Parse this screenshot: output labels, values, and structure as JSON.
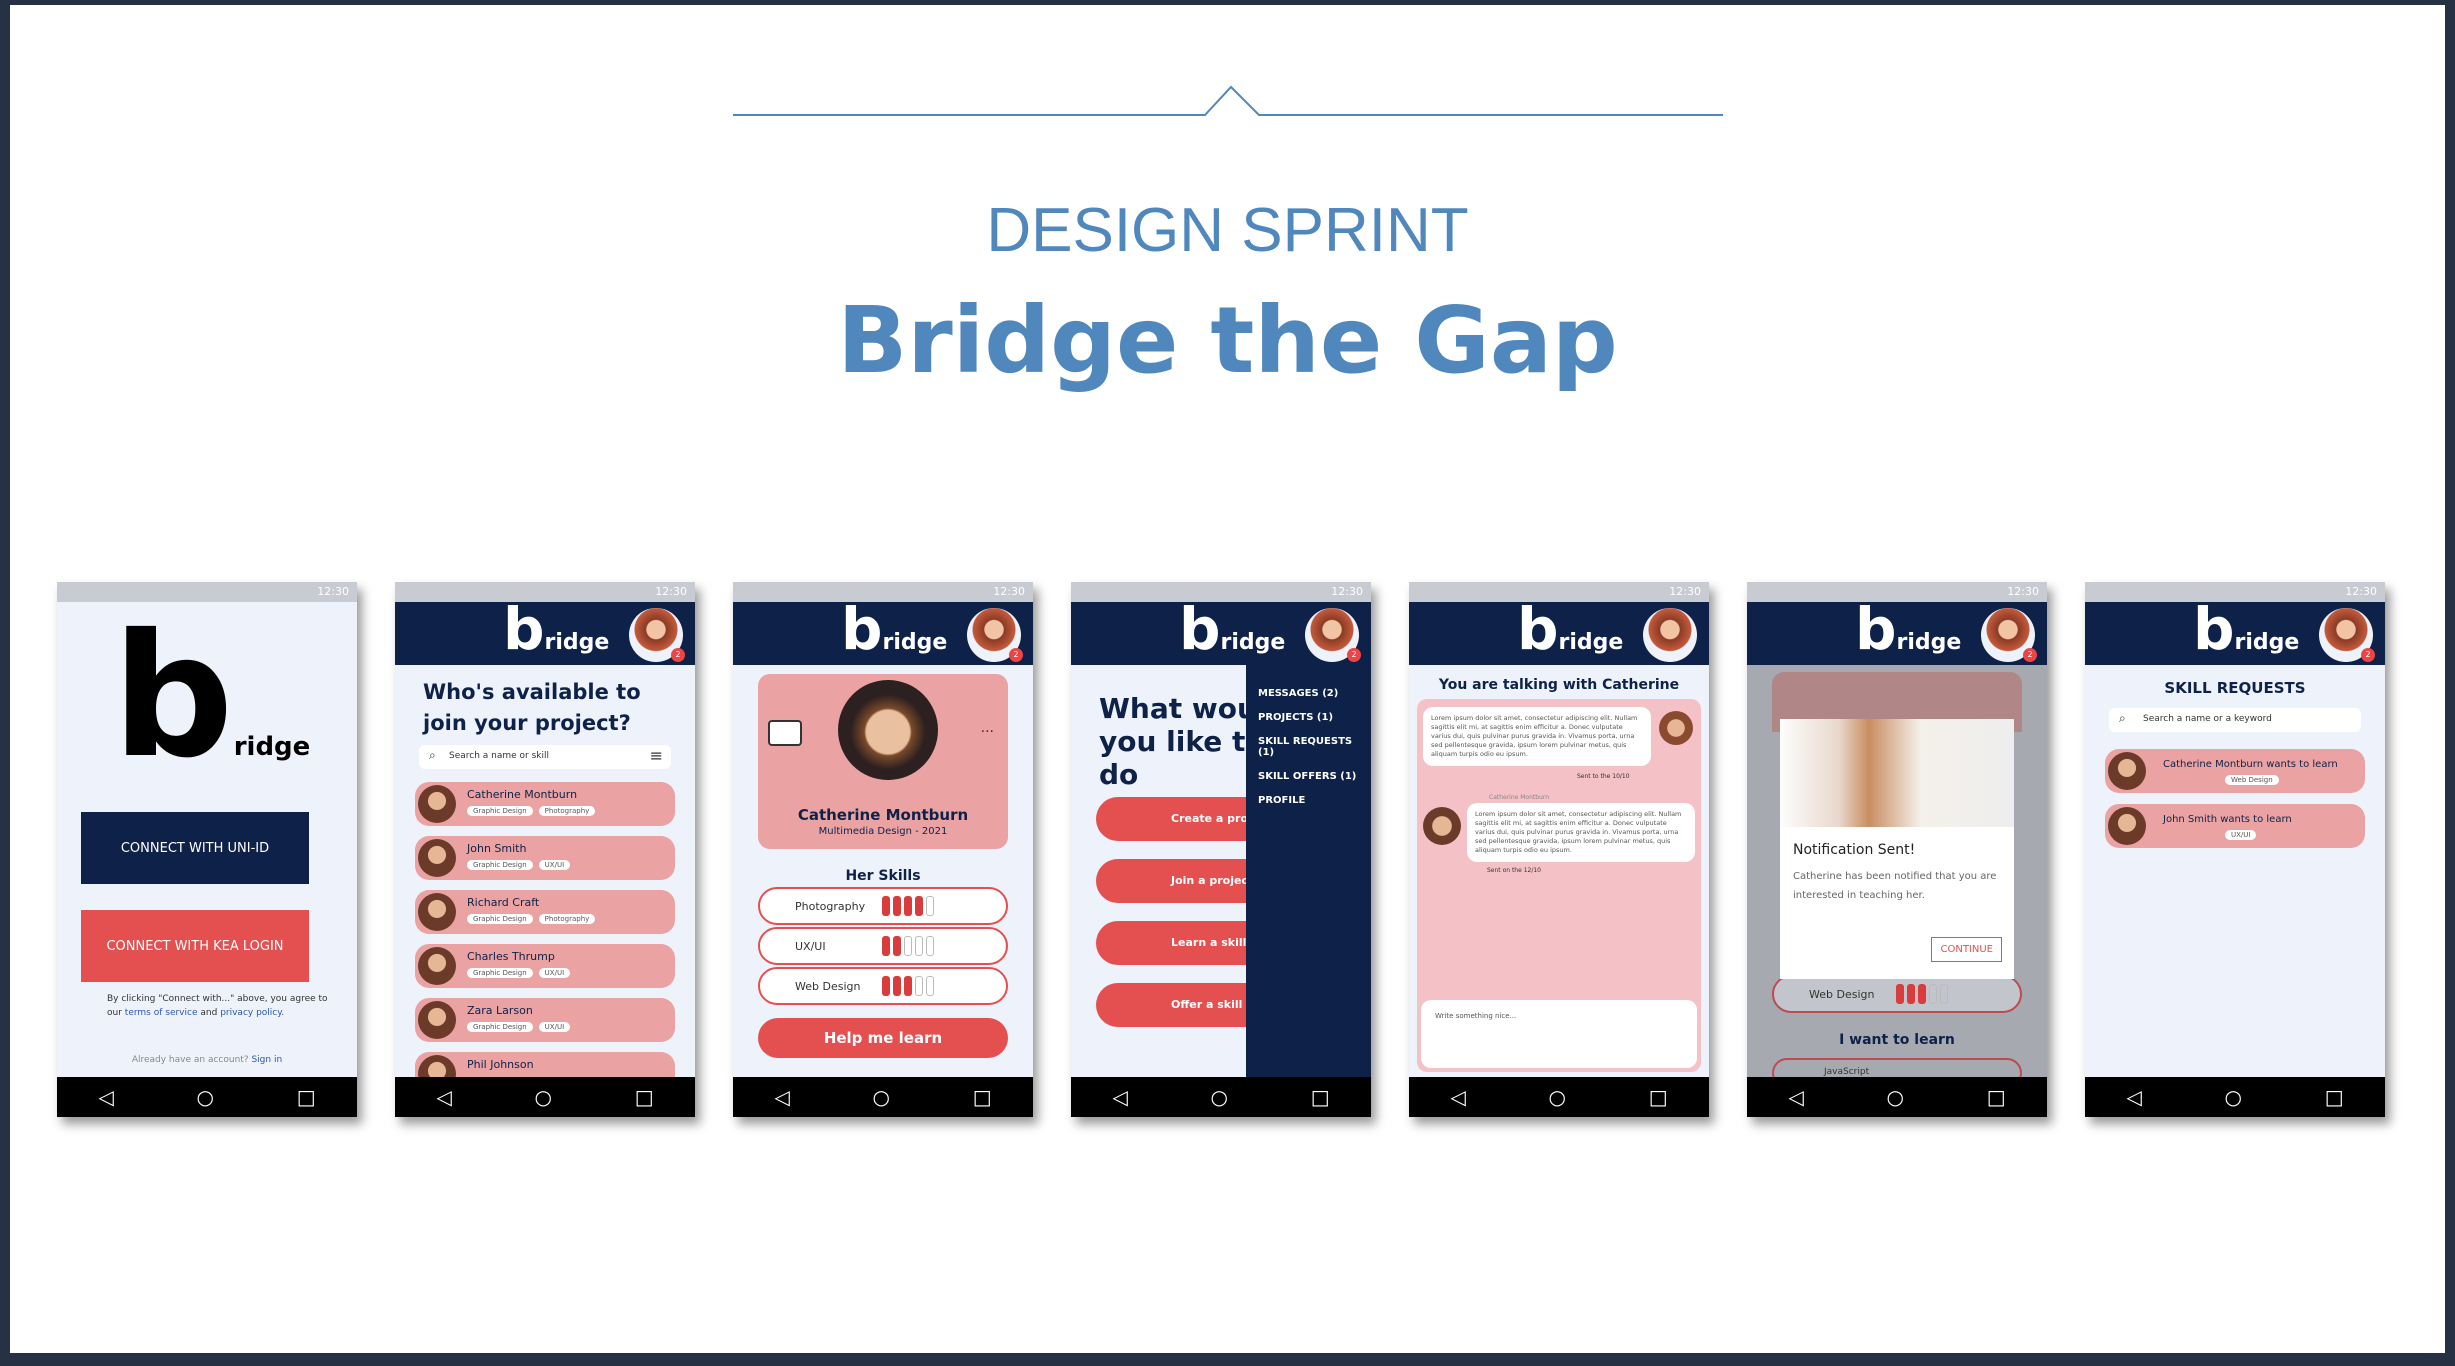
{
  "header": {
    "kicker": "DESIGN SPRINT",
    "title": "Bridge the Gap"
  },
  "status_time": "12:30",
  "icons": {
    "back": "◁",
    "home": "○",
    "recents": "□",
    "search": "⌕",
    "menu": "≡",
    "speech": "speech-bubble-icon",
    "more": "···"
  },
  "colors": {
    "navy": "#0e2249",
    "coral": "#e44f4f",
    "pink": "#eba2a2",
    "title_blue": "#5088bd"
  },
  "logo": {
    "b": "b",
    "rest": "ridge"
  },
  "badge": "2",
  "s1": {
    "uni_btn": "CONNECT WITH UNI-ID",
    "kea_btn": "CONNECT WITH KEA LOGIN",
    "legal_1": "By clicking \"Connect with...\" above, you agree to",
    "legal_2a": "our",
    "legal_terms": "terms of service",
    "legal_and": "and",
    "legal_privacy": "privacy policy.",
    "account": "Already have an account?",
    "signin": "Sign in"
  },
  "s2": {
    "heading": "Who's available to join your project?",
    "search_placeholder": "Search a name or skill",
    "people": [
      {
        "name": "Catherine Montburn",
        "tags": [
          "Graphic Design",
          "Photography"
        ]
      },
      {
        "name": "John Smith",
        "tags": [
          "Graphic Design",
          "UX/UI"
        ]
      },
      {
        "name": "Richard Craft",
        "tags": [
          "Graphic Design",
          "Photography"
        ]
      },
      {
        "name": "Charles Thrump",
        "tags": [
          "Graphic Design",
          "UX/UI"
        ]
      },
      {
        "name": "Zara Larson",
        "tags": [
          "Graphic Design",
          "UX/UI"
        ]
      },
      {
        "name": "Phil Johnson",
        "tags": []
      }
    ]
  },
  "s3": {
    "name": "Catherine Montburn",
    "program": "Multimedia Design - 2021",
    "skills_title": "Her Skills",
    "skills": [
      {
        "label": "Photography",
        "level": 4,
        "max": 5
      },
      {
        "label": "UX/UI",
        "level": 2,
        "max": 5
      },
      {
        "label": "Web Design",
        "level": 3,
        "max": 5
      }
    ],
    "cta": "Help me learn"
  },
  "s4": {
    "question": "What would you like to do",
    "buttons": [
      "Create a project",
      "Join a project",
      "Learn a skill",
      "Offer a skill"
    ],
    "menu": [
      "MESSAGES (2)",
      "PROJECTS (1)",
      "SKILL REQUESTS (1)",
      "SKILL OFFERS (1)",
      "PROFILE"
    ]
  },
  "s5": {
    "heading": "You are talking with Catherine",
    "msg": "Lorem ipsum dolor sit amet, consectetur adipiscing elit. Nullam sagittis elit mi, at sagittis enim efficitur a. Donec vulputate varius dui, quis pulvinar purus gravida in. Vivamus porta, urna sed pellentesque gravida, ipsum lorem pulvinar metus, quis aliquam turpis odio eu ipsum.",
    "sent1": "Sent to the 10/10",
    "sender": "Catherine Montburn",
    "sent2": "Sent on the 12/10",
    "input_placeholder": "Write something nice..."
  },
  "s6": {
    "dialog_title": "Notification Sent!",
    "dialog_body": "Catherine has been notified that you are interested in teaching her.",
    "continue": "CONTINUE",
    "skill_behind": "Web Design",
    "learn_title": "I want to learn",
    "behind_item": "JavaScript"
  },
  "s7": {
    "heading": "SKILL REQUESTS",
    "search_placeholder": "Search a name or a keyword",
    "requests": [
      {
        "text": "Catherine Montburn wants to learn",
        "tag": "Web Design"
      },
      {
        "text": "John Smith wants to learn",
        "tag": "UX/UI"
      }
    ]
  }
}
